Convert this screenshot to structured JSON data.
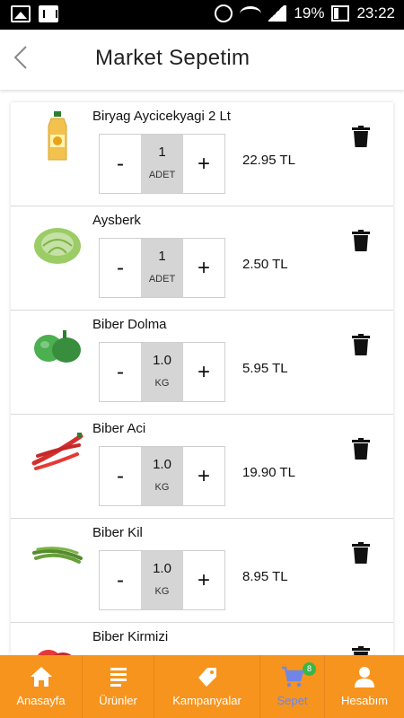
{
  "status_bar": {
    "battery": "19%",
    "time": "23:22"
  },
  "header": {
    "title": "Market Sepetim"
  },
  "cart": {
    "items": [
      {
        "name": "Biryag Aycicekyagi 2 Lt",
        "qty": "1",
        "unit": "ADET",
        "price": "22.95 TL",
        "image_icon": "oil-bottle-icon"
      },
      {
        "name": "Aysberk",
        "qty": "1",
        "unit": "ADET",
        "price": "2.50 TL",
        "image_icon": "lettuce-icon"
      },
      {
        "name": "Biber Dolma",
        "qty": "1.0",
        "unit": "KG",
        "price": "5.95 TL",
        "image_icon": "bell-pepper-icon"
      },
      {
        "name": "Biber Aci",
        "qty": "1.0",
        "unit": "KG",
        "price": "19.90 TL",
        "image_icon": "chili-pepper-icon"
      },
      {
        "name": "Biber Kil",
        "qty": "1.0",
        "unit": "KG",
        "price": "8.95 TL",
        "image_icon": "green-pepper-icon"
      },
      {
        "name": "Biber Kirmizi",
        "image_icon": "red-pepper-icon"
      }
    ],
    "minus_label": "-",
    "plus_label": "+"
  },
  "bottom_nav": {
    "items": [
      {
        "label": "Anasayfa",
        "icon": "home-icon"
      },
      {
        "label": "Ürünler",
        "icon": "list-icon"
      },
      {
        "label": "Kampanyalar",
        "icon": "tag-icon"
      },
      {
        "label": "Sepet",
        "icon": "cart-icon",
        "badge": "8",
        "active": true
      },
      {
        "label": "Hesabım",
        "icon": "user-icon"
      }
    ]
  },
  "colors": {
    "nav_bg": "#f7941d",
    "active_label": "#6f86e6",
    "badge": "#3bb54a"
  }
}
